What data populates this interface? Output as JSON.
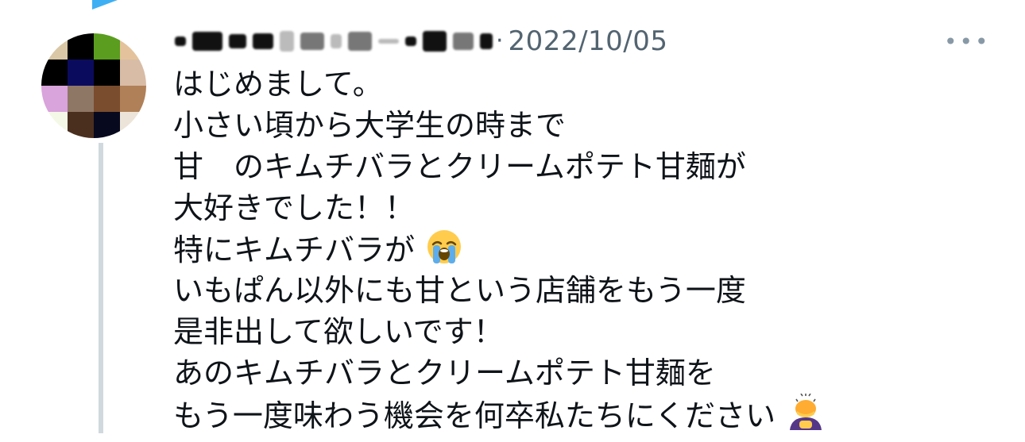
{
  "post": {
    "date": "2022/10/05",
    "separator": "·",
    "more_label": "•••",
    "lines": [
      "はじめまして。",
      "小さい頃から大学生の時まで",
      "甘　のキムチバラとクリームポテト甘麺が",
      "大好きでした！！",
      "特にキムチバラが",
      "いもぱん以外にも甘という店舗をもう一度",
      "是非出して欲しいです！",
      "あのキムチバラとクリームポテト甘麺を",
      "もう一度味わう機会を何卒私たちにください"
    ],
    "emojis": {
      "crying": "loudly-crying-face-icon",
      "bowing": "person-bowing-icon"
    }
  },
  "colors": {
    "text": "#0f1419",
    "meta": "#536471",
    "thread_line": "#cfd9de",
    "accent": "#1da1f2"
  }
}
